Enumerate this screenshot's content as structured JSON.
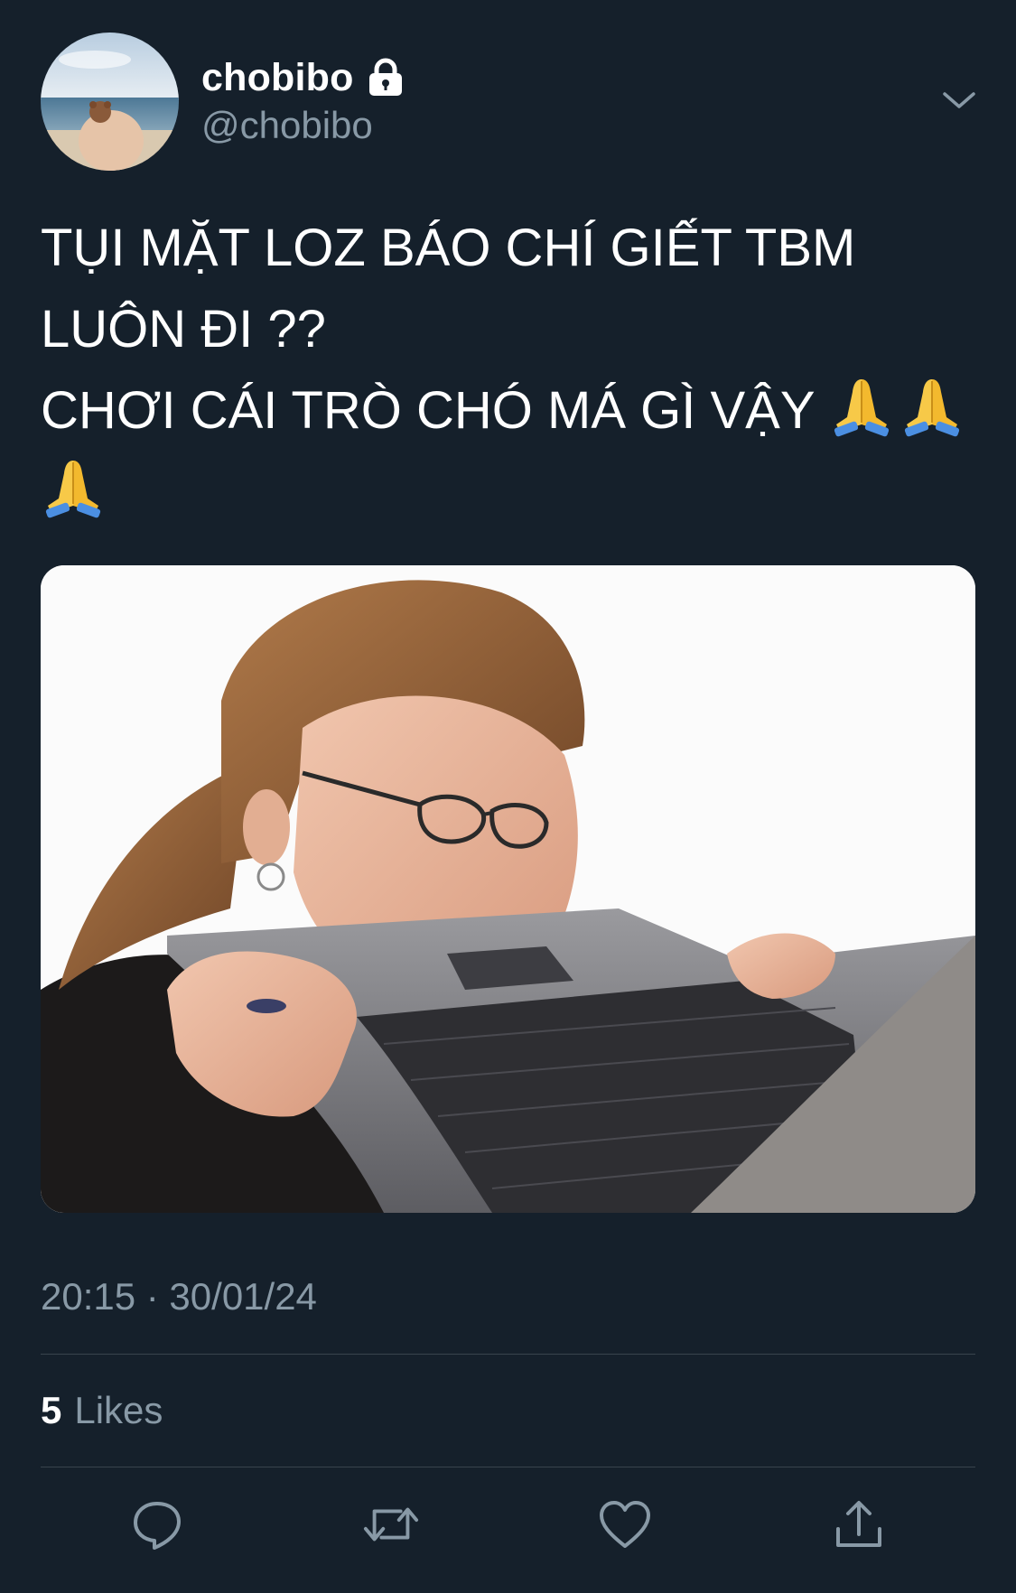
{
  "user": {
    "display_name": "chobibo",
    "handle": "@chobibo",
    "protected_icon": "lock-icon"
  },
  "tweet": {
    "text_lines": [
      "TỤI MẶT LOZ BÁO CHÍ GIẾT TBM",
      "LUÔN ĐI ??",
      "CHƠI CÁI TRÒ CHÓ MÁ GÌ VẬY"
    ],
    "emoji": "folded-hands",
    "emoji_count": 3,
    "timestamp": "20:15 · 30/01/24"
  },
  "stats": {
    "likes_count": "5",
    "likes_label": "Likes"
  },
  "actions": {
    "reply_icon": "reply-icon",
    "retweet_icon": "retweet-icon",
    "like_icon": "heart-icon",
    "share_icon": "share-icon"
  },
  "colors": {
    "background": "#15202b",
    "secondary_text": "#8899a6",
    "divider": "#38444d"
  }
}
